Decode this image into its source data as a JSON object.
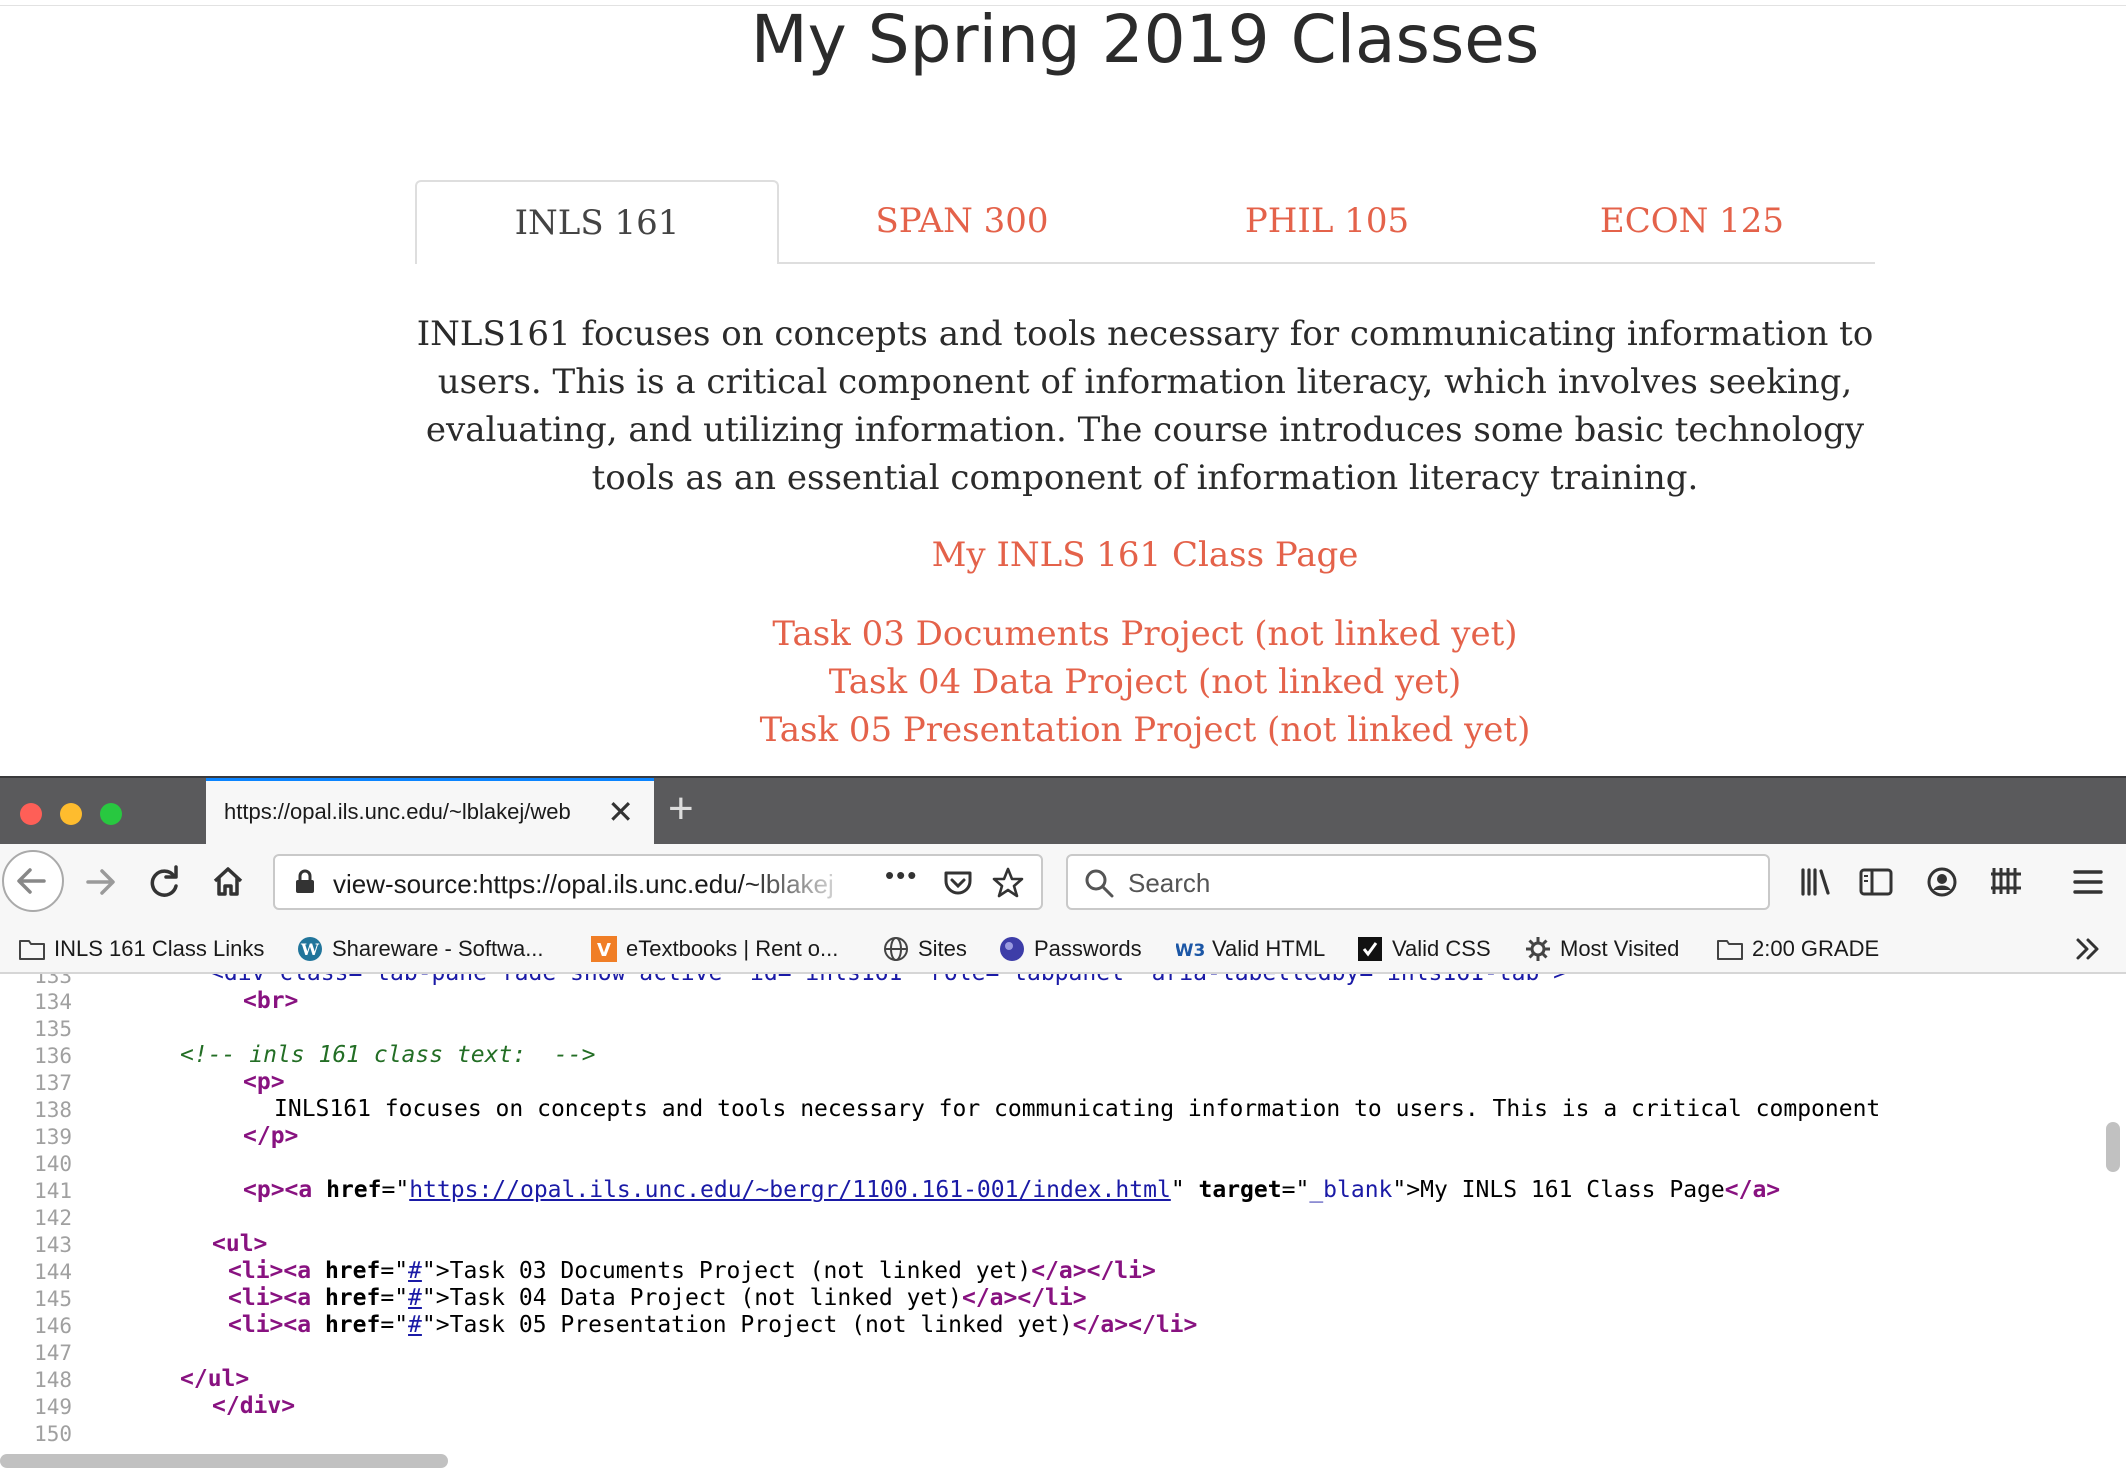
{
  "page": {
    "title": "My Spring 2019 Classes",
    "tabs": [
      "INLS 161",
      "SPAN 300",
      "PHIL 105",
      "ECON 125"
    ],
    "description": "INLS161 focuses on concepts and tools necessary for communicating information to users. This is a critical component of information literacy, which involves seeking, evaluating, and utilizing information. The course introduces some basic technology tools as an essential component of information literacy training.",
    "class_link": "My INLS 161 Class Page",
    "tasks": [
      "Task 03 Documents Project (not linked yet)",
      "Task 04 Data Project (not linked yet)",
      "Task 05 Presentation Project (not linked yet)"
    ]
  },
  "browser": {
    "tab_title": "https://opal.ils.unc.edu/~lblakej/web",
    "url": "view-source:https://opal.ils.unc.edu/~lblakej",
    "search_placeholder": "Search",
    "bookmarks": [
      {
        "label": "INLS 161 Class Links",
        "icon": "folder-icon"
      },
      {
        "label": "Shareware - Softwa...",
        "icon": "wordpress-icon"
      },
      {
        "label": "eTextbooks | Rent o...",
        "icon": "vitalsource-icon"
      },
      {
        "label": "Sites",
        "icon": "globe-icon"
      },
      {
        "label": "Passwords",
        "icon": "passwords-icon"
      },
      {
        "label": "Valid HTML",
        "icon": "w3c-icon"
      },
      {
        "label": "Valid CSS",
        "icon": "css-badge-icon"
      },
      {
        "label": "Most Visited",
        "icon": "gear-icon"
      },
      {
        "label": "2:00 GRADE",
        "icon": "folder-icon"
      }
    ],
    "colors": {
      "accent": "#e4624a",
      "tab_highlight": "#0a84ff",
      "titlebar": "#5a5a5c"
    }
  },
  "source": {
    "line_numbers": [
      "133",
      "134",
      "135",
      "136",
      "137",
      "138",
      "139",
      "140",
      "141",
      "142",
      "143",
      "144",
      "145",
      "146",
      "147",
      "148",
      "149",
      "150"
    ],
    "line133_partial": "<div class=\"tab-pane fade show active\" id=\"inls161\" role=\"tabpanel\" aria-labelledby=\"inls161-tab\">",
    "comment": "<!-- inls 161 class text:  -->",
    "p_text": "INLS161 focuses on concepts and tools necessary for communicating information to users. This is a critical component",
    "href_url": "https://opal.ils.unc.edu/~bergr/1100.161-001/index.html",
    "target_value": "_blank",
    "link_text": "My INLS 161 Class Page",
    "hash": "#",
    "task_texts": [
      "Task 03 Documents Project (not linked yet)",
      "Task 04 Data Project (not linked yet)",
      "Task 05 Presentation Project (not linked yet)"
    ]
  }
}
